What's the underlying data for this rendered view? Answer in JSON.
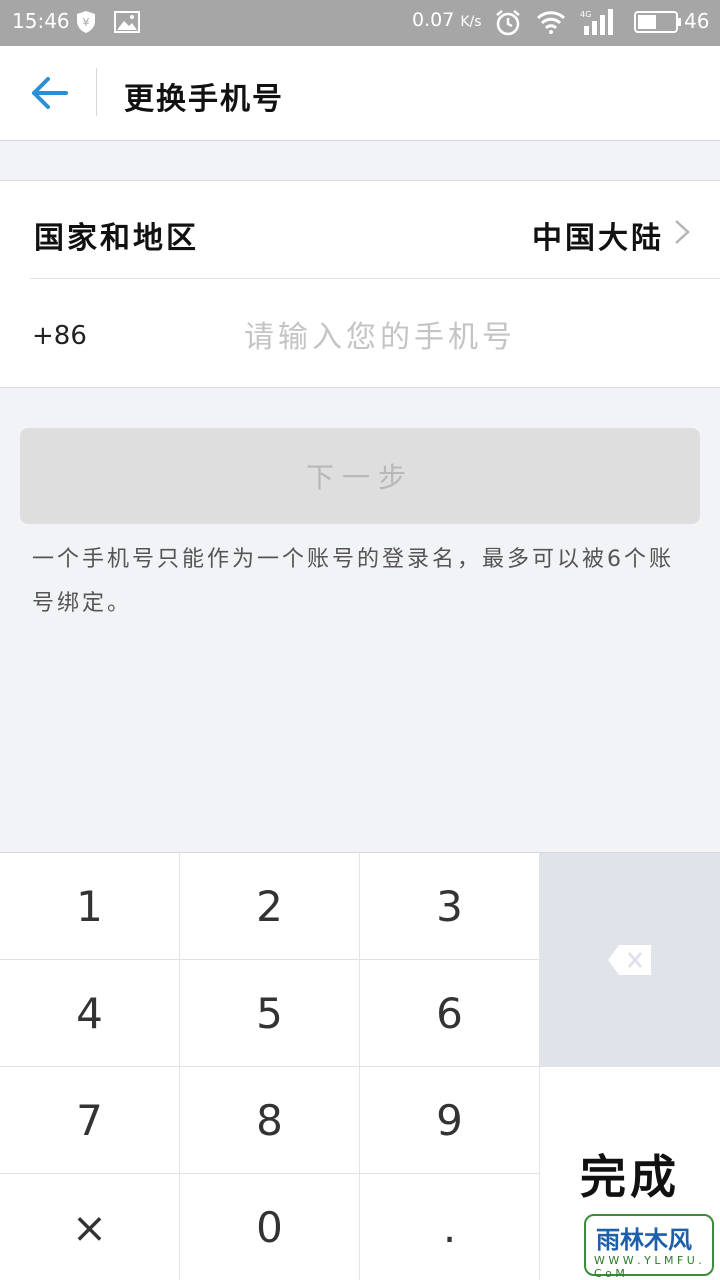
{
  "status_bar": {
    "time": "15:46",
    "net_speed": "0.07",
    "net_speed_unit": "K/s",
    "network": "4G",
    "battery": "46",
    "icons": [
      "shield-yen-icon",
      "image-icon",
      "alarm-icon",
      "wifi-icon",
      "signal-icon",
      "battery-icon"
    ]
  },
  "header": {
    "title": "更换手机号",
    "back_icon": "arrow-left-icon",
    "accent_color": "#2b8fd6"
  },
  "form": {
    "region_label": "国家和地区",
    "region_value": "中国大陆",
    "country_code": "+86",
    "phone_placeholder": "请输入您的手机号",
    "phone_value": ""
  },
  "next_button": {
    "label": "下一步",
    "enabled": false
  },
  "hint": "一个手机号只能作为一个账号的登录名，最多可以被6个账号绑定。",
  "keypad": {
    "keys": [
      {
        "label": "1",
        "name": "key-1"
      },
      {
        "label": "2",
        "name": "key-2"
      },
      {
        "label": "3",
        "name": "key-3"
      },
      {
        "label": "4",
        "name": "key-4"
      },
      {
        "label": "5",
        "name": "key-5"
      },
      {
        "label": "6",
        "name": "key-6"
      },
      {
        "label": "7",
        "name": "key-7"
      },
      {
        "label": "8",
        "name": "key-8"
      },
      {
        "label": "9",
        "name": "key-9"
      },
      {
        "label": "×",
        "name": "key-x"
      },
      {
        "label": "0",
        "name": "key-0"
      },
      {
        "label": ".",
        "name": "key-dot"
      }
    ],
    "delete_icon": "backspace-icon",
    "done_label": "完成"
  },
  "watermark": {
    "text": "雨林木风",
    "url": "W W W . Y L M F U . C o M"
  }
}
